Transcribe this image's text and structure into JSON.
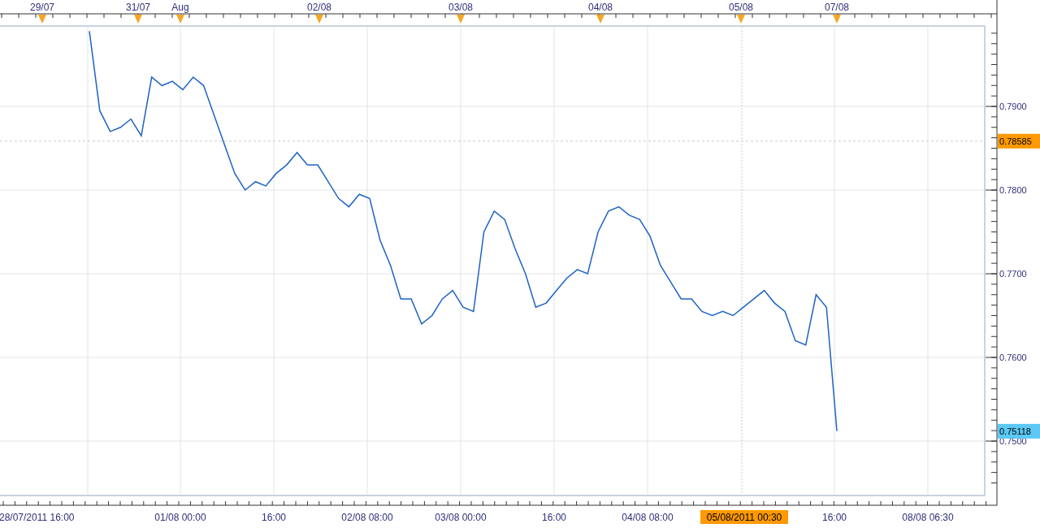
{
  "top_axis": {
    "markers": [
      {
        "label": "29/07"
      },
      {
        "label": "31/07"
      },
      {
        "label": "Aug"
      },
      {
        "label": "02/08"
      },
      {
        "label": "03/08"
      },
      {
        "label": "04/08"
      },
      {
        "label": "05/08"
      },
      {
        "label": "07/08"
      }
    ]
  },
  "bottom_axis": {
    "labels": [
      {
        "label": "28/07/2011 16:00",
        "highlighted": false
      },
      {
        "label": "01/08 00:00",
        "highlighted": false
      },
      {
        "label": "16:00",
        "highlighted": false
      },
      {
        "label": "02/08 08:00",
        "highlighted": false
      },
      {
        "label": "03/08 00:00",
        "highlighted": false
      },
      {
        "label": "16:00",
        "highlighted": false
      },
      {
        "label": "04/08 08:00",
        "highlighted": false
      },
      {
        "label": "05/08/2011 00:30",
        "highlighted": true
      },
      {
        "label": "16:00",
        "highlighted": false
      },
      {
        "label": "08/08 06:30",
        "highlighted": false
      }
    ]
  },
  "price_axis": {
    "last_price": "0.75118"
  },
  "chart_data": {
    "type": "line",
    "grid": true,
    "ylim": [
      0.7423,
      0.7996
    ],
    "ref_lines": [
      {
        "axis": "y",
        "value": 0.78585,
        "label": "0.78585"
      }
    ],
    "yticks": [
      {
        "value": 0.75,
        "label": "0.7500"
      },
      {
        "value": 0.76,
        "label": "0.7600"
      },
      {
        "value": 0.77,
        "label": "0.7700"
      },
      {
        "value": 0.78,
        "label": "0.7800"
      },
      {
        "value": 0.79,
        "label": "0.7900"
      }
    ],
    "series": [
      {
        "color": "#1e63c4",
        "values": [
          0.799,
          0.7895,
          0.787,
          0.7875,
          0.7885,
          0.7865,
          0.7935,
          0.7925,
          0.793,
          0.792,
          0.7935,
          0.7925,
          0.789,
          0.7855,
          0.782,
          0.78,
          0.781,
          0.7805,
          0.782,
          0.783,
          0.7845,
          0.783,
          0.783,
          0.781,
          0.779,
          0.778,
          0.7795,
          0.779,
          0.774,
          0.771,
          0.767,
          0.767,
          0.764,
          0.765,
          0.767,
          0.768,
          0.766,
          0.7655,
          0.775,
          0.7775,
          0.7765,
          0.773,
          0.77,
          0.766,
          0.7665,
          0.768,
          0.7695,
          0.7705,
          0.77,
          0.775,
          0.7775,
          0.778,
          0.777,
          0.7765,
          0.7745,
          0.771,
          0.769,
          0.767,
          0.767,
          0.7655,
          0.765,
          0.7655,
          0.765,
          0.766,
          0.767,
          0.768,
          0.7665,
          0.7655,
          0.762,
          0.7615,
          0.7675,
          0.766,
          0.7512
        ]
      }
    ]
  }
}
